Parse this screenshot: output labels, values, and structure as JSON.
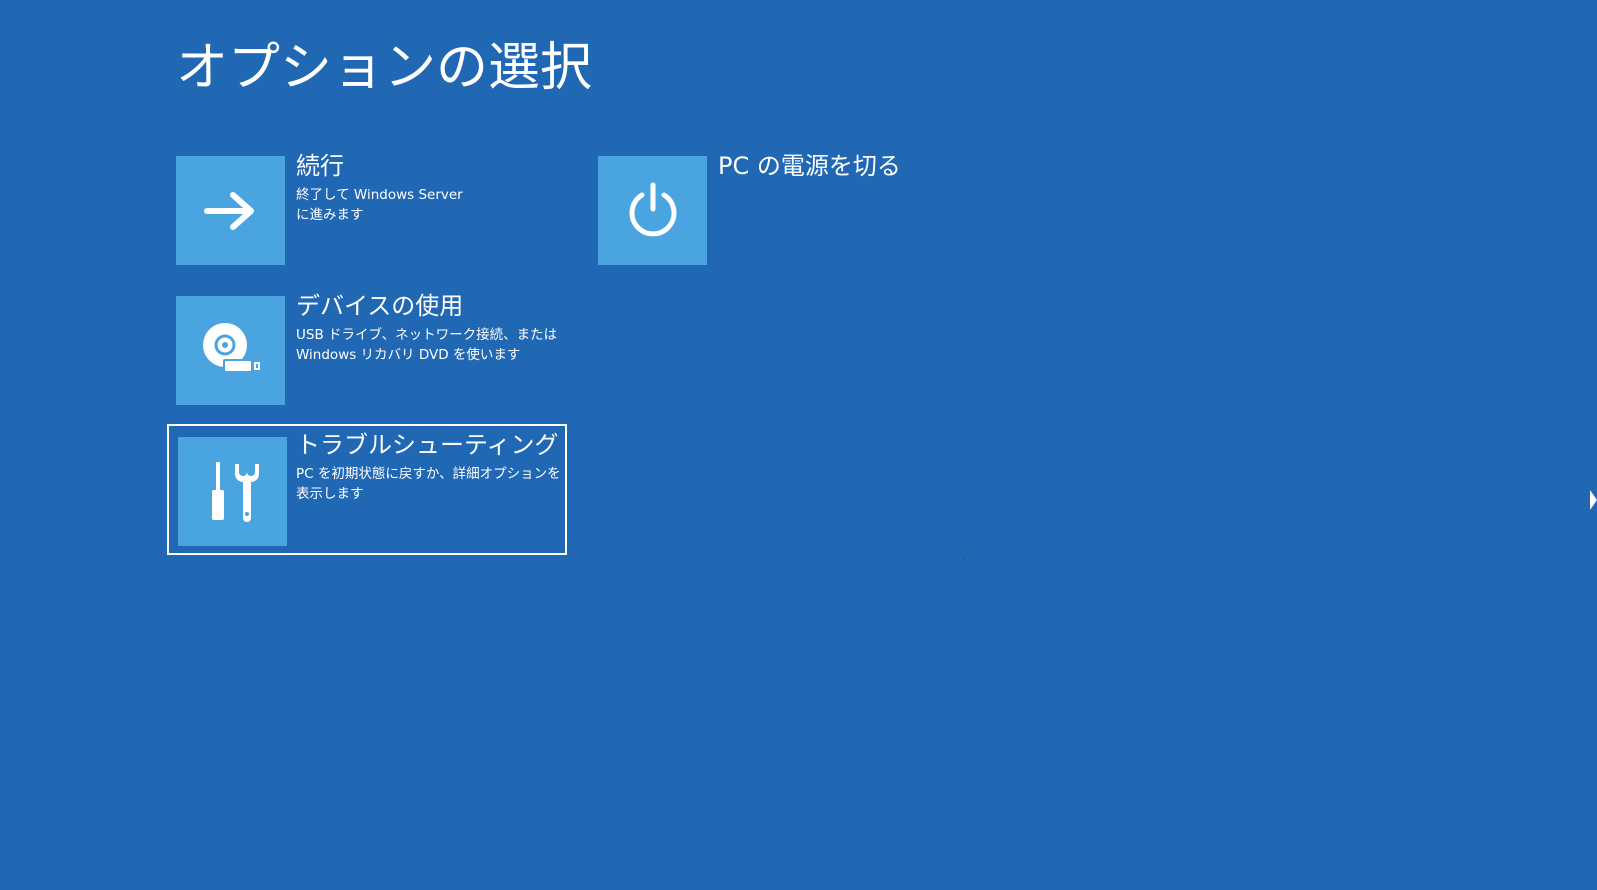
{
  "page": {
    "title": "オプションの選択"
  },
  "options": {
    "continue": {
      "label": "続行",
      "desc_line1": "終了して Windows Server",
      "desc_line2": "に進みます",
      "icon": "arrow-right-icon"
    },
    "power_off": {
      "label": "PC の電源を切る",
      "icon": "power-icon"
    },
    "use_device": {
      "label": "デバイスの使用",
      "desc_line1": "USB ドライブ、ネットワーク接続、または",
      "desc_line2": "Windows リカバリ DVD を使います",
      "icon": "disc-drive-icon"
    },
    "troubleshoot": {
      "label": "トラブルシューティング",
      "desc_line1": "PC を初期状態に戻すか、詳細オプションを",
      "desc_line2": "表示します",
      "icon": "tools-icon",
      "selected": true
    }
  },
  "colors": {
    "background": "#2067b4",
    "tile": "#4aa4df",
    "text": "#ffffff"
  }
}
